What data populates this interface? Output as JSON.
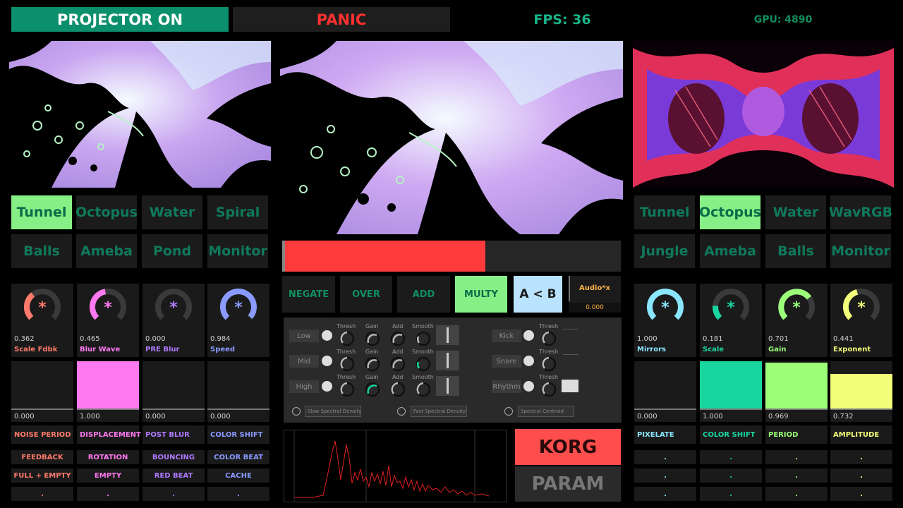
{
  "header": {
    "projector_label": "PROJECTOR ON",
    "panic_label": "PANIC",
    "fps_label": "FPS: 36",
    "gpu_label": "GPU: 4890"
  },
  "left_deck": {
    "scenes": [
      "Tunnel",
      "Octopus",
      "Water",
      "Spiral",
      "Balls",
      "Ameba",
      "Pond",
      "Monitor"
    ],
    "active_scene": "Tunnel",
    "knobs": [
      {
        "label": "Scale Fdbk",
        "value": "0.362",
        "level": 0.362,
        "color": "#ff7a6a"
      },
      {
        "label": "Blur Wave",
        "value": "0.465",
        "level": 0.465,
        "color": "#ff7af0"
      },
      {
        "label": "PRE Blur",
        "value": "0.000",
        "level": 0.0,
        "color": "#b07aff"
      },
      {
        "label": "Speed",
        "value": "0.984",
        "level": 0.984,
        "color": "#8a9aff"
      }
    ],
    "faders": [
      {
        "label": "NOISE PERIOD",
        "value": "0.000",
        "level": 0.0,
        "color": "#ff7a6a"
      },
      {
        "label": "DISPLACEMENT",
        "value": "1.000",
        "level": 1.0,
        "color": "#ff7af0"
      },
      {
        "label": "POST BLUR",
        "value": "0.000",
        "level": 0.0,
        "color": "#b07aff"
      },
      {
        "label": "COLOR SHIFT",
        "value": "0.000",
        "level": 0.0,
        "color": "#8a9aff"
      }
    ],
    "toggles_row1": [
      "FEEDBACK",
      "ROTATION",
      "BOUNCING",
      "COLOR BEAT"
    ],
    "toggles_row2": [
      "FULL + EMPTY",
      "EMPTY",
      "RED BEAT",
      "CACHE"
    ],
    "toggles_row3": [
      ".",
      ".",
      ".",
      "."
    ]
  },
  "right_deck": {
    "scenes": [
      "Tunnel",
      "Octopus",
      "Water",
      "WavRGB",
      "Jungle",
      "Ameba",
      "Balls",
      "Monitor"
    ],
    "active_scene": "Octopus",
    "knobs": [
      {
        "label": "Mirrors",
        "value": "1.000",
        "level": 1.0,
        "color": "#8ae6ff"
      },
      {
        "label": "Scale",
        "value": "0.181",
        "level": 0.181,
        "color": "#19d6a0"
      },
      {
        "label": "Gain",
        "value": "0.701",
        "level": 0.701,
        "color": "#9cff7a"
      },
      {
        "label": "Exponent",
        "value": "0.441",
        "level": 0.441,
        "color": "#f3ff7a"
      }
    ],
    "faders": [
      {
        "label": "PIXELATE",
        "value": "0.000",
        "level": 0.0,
        "color": "#8ae6ff"
      },
      {
        "label": "COLOR SHIFT",
        "value": "1.000",
        "level": 1.0,
        "color": "#19d6a0"
      },
      {
        "label": "PERIOD",
        "value": "0.969",
        "level": 0.969,
        "color": "#9cff7a"
      },
      {
        "label": "AMPLITUDE",
        "value": "0.732",
        "level": 0.732,
        "color": "#f3ff7a"
      }
    ],
    "toggles_row1": [
      ".",
      ".",
      ".",
      "."
    ],
    "toggles_row2": [
      ".",
      ".",
      ".",
      "."
    ],
    "toggles_row3": [
      ".",
      ".",
      ".",
      "."
    ]
  },
  "center": {
    "crossfader": {
      "level": 0.6
    },
    "blend_modes": [
      "NEGATE",
      "OVER",
      "ADD",
      "MULTY"
    ],
    "active_blend": "MULTY",
    "ab_label": "A < B",
    "audio_label": "Audio*x",
    "audio_value": "0.000",
    "bands": [
      {
        "name": "Low",
        "labels": [
          "Thresh",
          "Gain",
          "Add",
          "Smooth"
        ]
      },
      {
        "name": "Mid",
        "labels": [
          "Thresh",
          "Gain",
          "Add",
          "Smooth"
        ]
      },
      {
        "name": "High",
        "labels": [
          "Thresh",
          "Gain",
          "Add",
          "Smooth"
        ]
      }
    ],
    "beats": [
      {
        "name": "Kick",
        "label": "Thresh"
      },
      {
        "name": "Snare",
        "label": "Thresh"
      },
      {
        "name": "Rhythm",
        "label": "Thresh"
      }
    ],
    "spectral_fields": [
      "Slow Spectral Density",
      "Fast Spectral Density",
      "Spectral Centroid"
    ],
    "korg_label": "KORG",
    "param_label": "PARAM"
  },
  "colors": {
    "projector_bg": "#0c8f6c",
    "panic_text": "#ff3030",
    "fps_text": "#19b58a",
    "crossfader_fill": "#ff3b3b",
    "korg_bg": "#ff4d4d",
    "ab_bg": "#b9e3ff",
    "active_scene_bg": "#86f086"
  }
}
